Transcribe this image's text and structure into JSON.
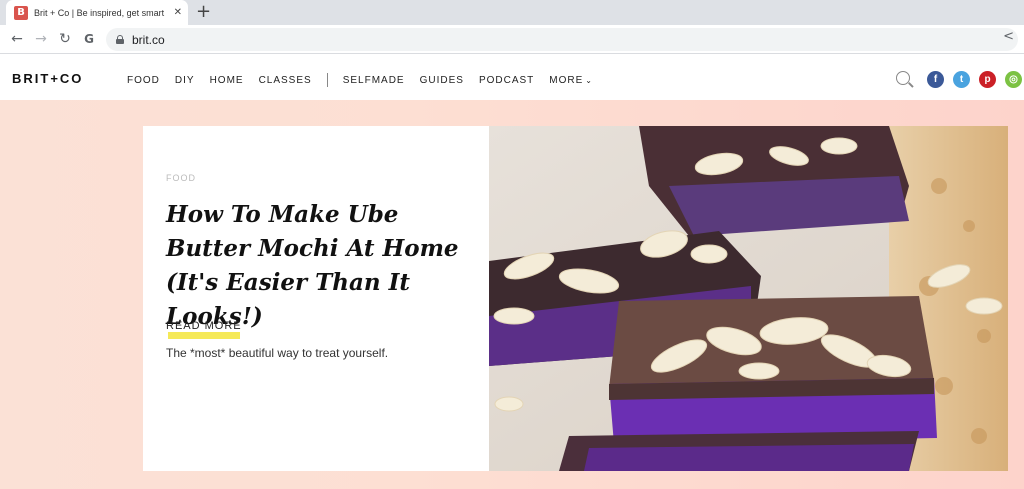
{
  "browser": {
    "tab_title": "Brit + Co | Be inspired, get smart",
    "favicon_letter": "B",
    "close_symbol": "✕",
    "new_tab_symbol": "+",
    "url": "brit.co"
  },
  "site": {
    "logo": "BRIT+CO",
    "nav": {
      "food": "FOOD",
      "diy": "DIY",
      "home": "HOME",
      "classes": "CLASSES",
      "selfmade": "SELFMADE",
      "guides": "GUIDES",
      "podcast": "PODCAST",
      "more": "MORE"
    },
    "social": [
      {
        "name": "facebook-icon",
        "glyph": "f",
        "color": "#3b5998"
      },
      {
        "name": "twitter-icon",
        "glyph": "t",
        "color": "#4aa3df"
      },
      {
        "name": "pinterest-icon",
        "glyph": "p",
        "color": "#cb2027"
      },
      {
        "name": "instagram-icon",
        "glyph": "◎",
        "color": "#7cc243"
      }
    ]
  },
  "hero": {
    "category": "FOOD",
    "headline": "How To Make Ube Butter Mochi At Home (It's Easier Than It Looks!)",
    "cta": "READ MORE",
    "dek": "The *most* beautiful way to treat yourself."
  }
}
